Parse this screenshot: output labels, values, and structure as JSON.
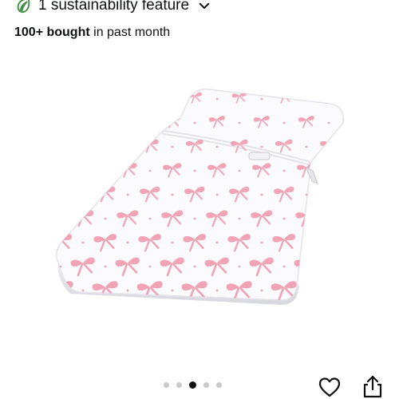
{
  "sustainability": {
    "label": "1 sustainability feature",
    "icon": "leaf-icon",
    "expand_icon": "chevron-down-icon",
    "color": "#3d8c40"
  },
  "purchase_stat": {
    "count": "100+ bought",
    "suffix": " in past month"
  },
  "product_image": {
    "subject": "pink bow print changing pad cover",
    "pattern_color": "#f0a4b6"
  },
  "carousel": {
    "total": 5,
    "active_index": 2
  },
  "actions": {
    "favorite_icon": "heart-icon",
    "share_icon": "share-icon"
  }
}
